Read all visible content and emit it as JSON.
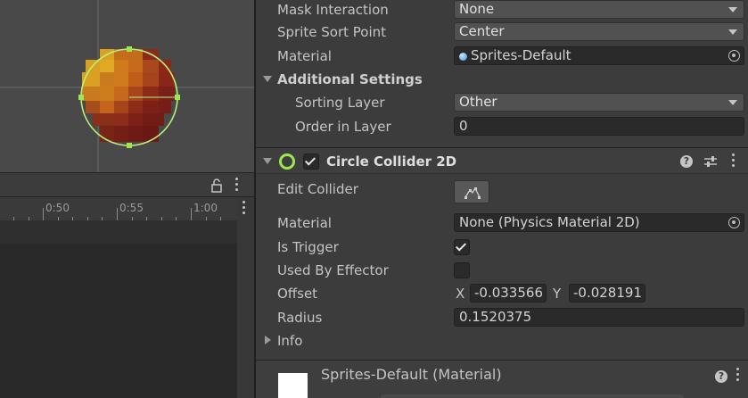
{
  "timeline": {
    "ticks": [
      "0:50",
      "0:55",
      "1:00"
    ]
  },
  "inspector": {
    "mask_interaction": {
      "label": "Mask Interaction",
      "value": "None"
    },
    "sprite_sort_point": {
      "label": "Sprite Sort Point",
      "value": "Center"
    },
    "material": {
      "label": "Material",
      "value": "Sprites-Default"
    },
    "additional_settings": {
      "label": "Additional Settings",
      "sorting_layer": {
        "label": "Sorting Layer",
        "value": "Other"
      },
      "order_in_layer": {
        "label": "Order in Layer",
        "value": "0"
      }
    },
    "circle_collider": {
      "title": "Circle Collider 2D",
      "enabled": true,
      "edit_collider_label": "Edit Collider",
      "material": {
        "label": "Material",
        "value": "None (Physics Material 2D)"
      },
      "is_trigger": {
        "label": "Is Trigger",
        "checked": true
      },
      "used_by_effector": {
        "label": "Used By Effector",
        "checked": false
      },
      "offset": {
        "label": "Offset",
        "x_label": "X",
        "x": "-0.033566",
        "y_label": "Y",
        "y": "-0.028191"
      },
      "radius": {
        "label": "Radius",
        "value": "0.1520375"
      },
      "info_label": "Info"
    },
    "material_preview": {
      "name": "Sprites-Default (Material)"
    }
  },
  "colors": {
    "collider_gizmo": "#b8f07a",
    "component_icon": "#9ee64f"
  }
}
